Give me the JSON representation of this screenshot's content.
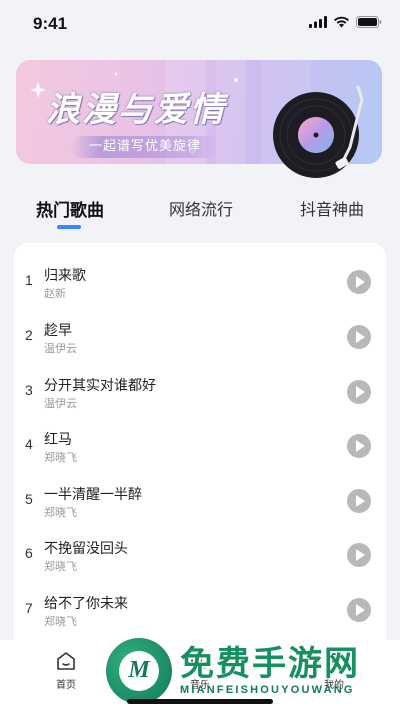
{
  "status_bar": {
    "time": "9:41"
  },
  "banner": {
    "title": "浪漫与爱情",
    "subtitle": "一起谱写优美旋律"
  },
  "tabs": [
    {
      "label": "热门歌曲",
      "active": true
    },
    {
      "label": "网络流行",
      "active": false
    },
    {
      "label": "抖音神曲",
      "active": false
    }
  ],
  "songs": [
    {
      "num": "1",
      "title": "归来歌",
      "artist": "赵新"
    },
    {
      "num": "2",
      "title": "趁早",
      "artist": "温伊云"
    },
    {
      "num": "3",
      "title": "分开其实对谁都好",
      "artist": "温伊云"
    },
    {
      "num": "4",
      "title": "红马",
      "artist": "郑晓飞"
    },
    {
      "num": "5",
      "title": "一半清醒一半醉",
      "artist": "郑晓飞"
    },
    {
      "num": "6",
      "title": "不挽留没回头",
      "artist": "郑晓飞"
    },
    {
      "num": "7",
      "title": "给不了你未来",
      "artist": "郑晓飞"
    }
  ],
  "bottom_nav": [
    {
      "label": "首页",
      "icon": "home-icon"
    },
    {
      "label": "音乐",
      "icon": "music-icon"
    },
    {
      "label": "我的",
      "icon": "profile-icon"
    }
  ],
  "watermark": {
    "title": "免费手游网",
    "subtitle": "MIANFEISHOUYOUWANG",
    "logo_letter": "M"
  },
  "colors": {
    "accent": "#3a86ff",
    "play_button": "#b8b8b8",
    "watermark_green": "#16905f"
  }
}
